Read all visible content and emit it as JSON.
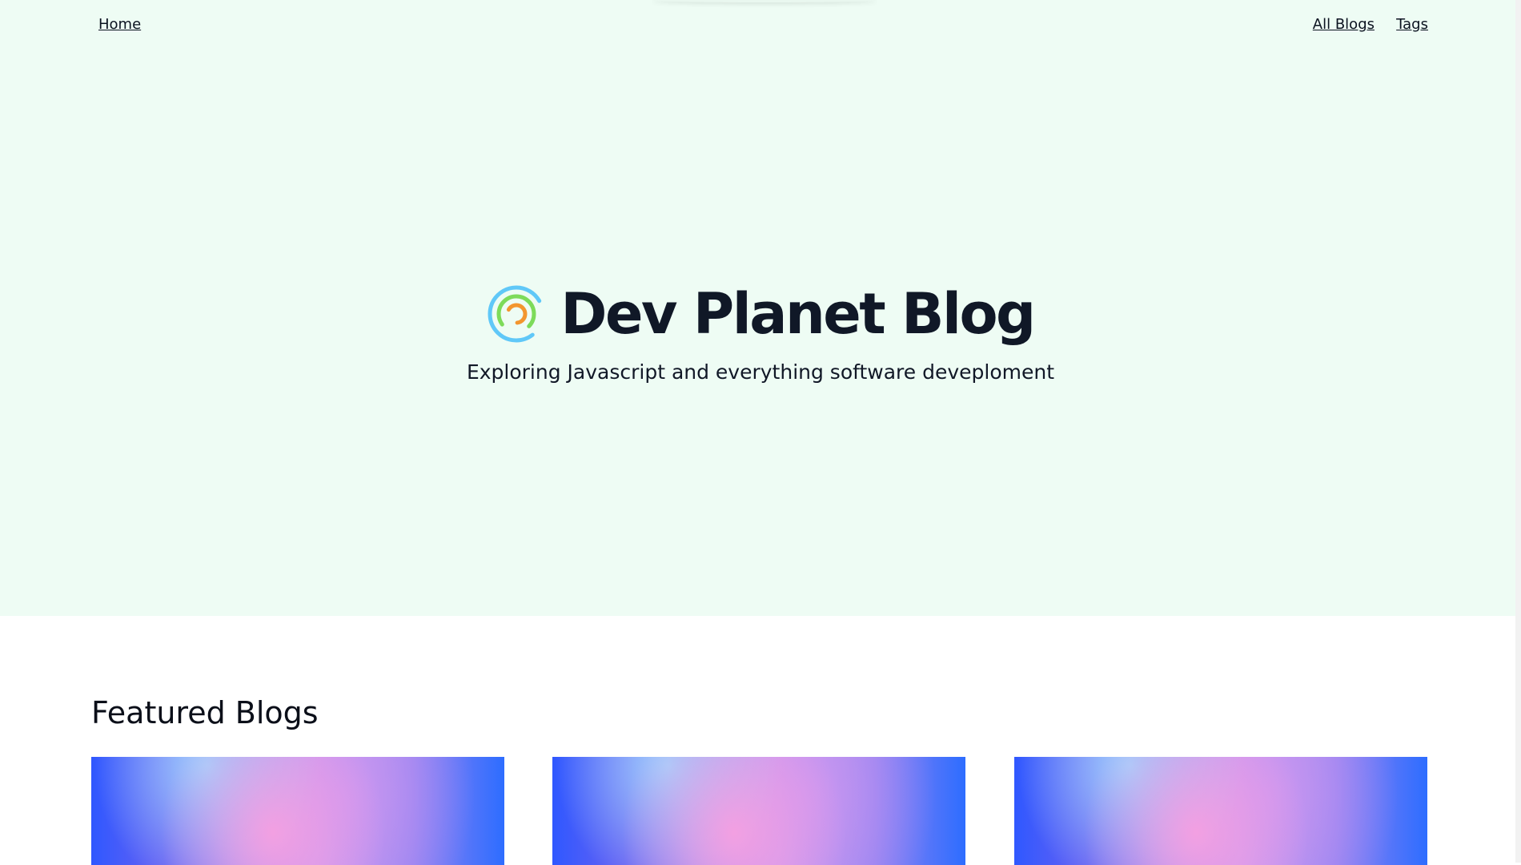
{
  "nav": {
    "home": "Home",
    "all_blogs": "All Blogs",
    "tags": "Tags"
  },
  "hero": {
    "title": "Dev Planet Blog",
    "subtitle": "Exploring Javascript and everything software deveplom‌ent",
    "background": "#eefcf4"
  },
  "featured": {
    "heading": "Featured Blogs",
    "cards": [
      {
        "image": "gradient-cover"
      },
      {
        "image": "gradient-cover"
      },
      {
        "image": "gradient-cover"
      }
    ]
  },
  "icons": {
    "logo": "dev-planet-logo-icon"
  },
  "colors": {
    "hero_bg": "#eefcf4",
    "text": "#111827",
    "logo_outer": "#60c8f8",
    "logo_middle": "#7ddb5a",
    "logo_inner": "#f3962f"
  }
}
